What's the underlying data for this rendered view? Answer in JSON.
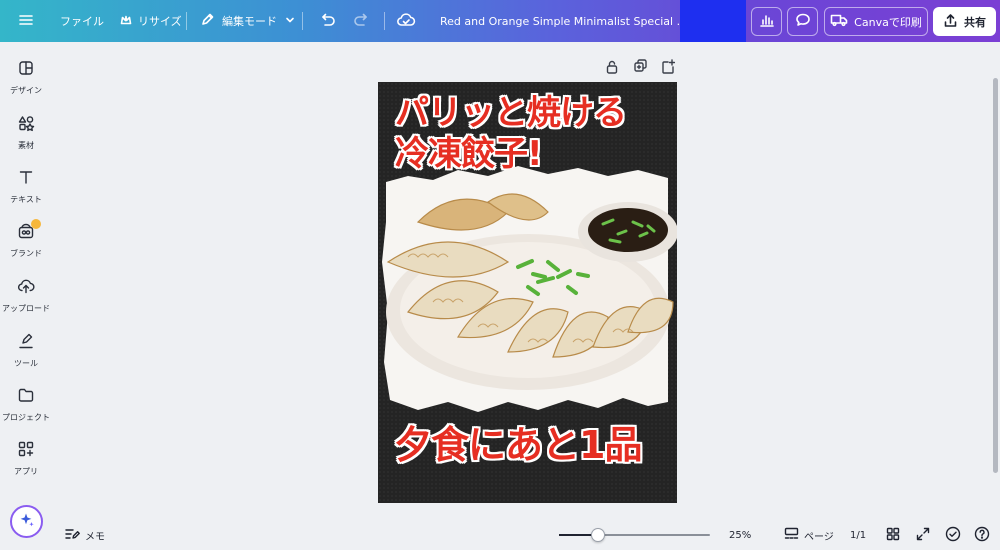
{
  "header": {
    "file_menu": "ファイル",
    "resize": "リサイズ",
    "edit_mode": "編集モード",
    "doc_title": "Red and Orange Simple Minimalist Special ...",
    "print_button": "Canvaで印刷",
    "share_button": "共有"
  },
  "sidebar": {
    "items": [
      {
        "label": "デザイン",
        "icon": "design-icon"
      },
      {
        "label": "素材",
        "icon": "elements-icon"
      },
      {
        "label": "テキスト",
        "icon": "text-icon"
      },
      {
        "label": "ブランド",
        "icon": "brand-icon"
      },
      {
        "label": "アップロード",
        "icon": "upload-icon"
      },
      {
        "label": "ツール",
        "icon": "draw-icon"
      },
      {
        "label": "プロジェクト",
        "icon": "folder-icon"
      },
      {
        "label": "アプリ",
        "icon": "apps-icon"
      }
    ]
  },
  "design": {
    "headline_line1": "パリッと焼ける",
    "headline_line2": "冷凍餃子!",
    "subline": "夕食にあと1品"
  },
  "footer": {
    "notes": "メモ",
    "zoom_value": 25,
    "zoom": "25%",
    "pages_label": "ページ",
    "page_counter": "1/1"
  },
  "colors": {
    "accent_red": "#e62e22",
    "canvas_dark": "#242424",
    "title_highlight": "#1e2ff0",
    "magic_border": "#8a5cf0"
  }
}
